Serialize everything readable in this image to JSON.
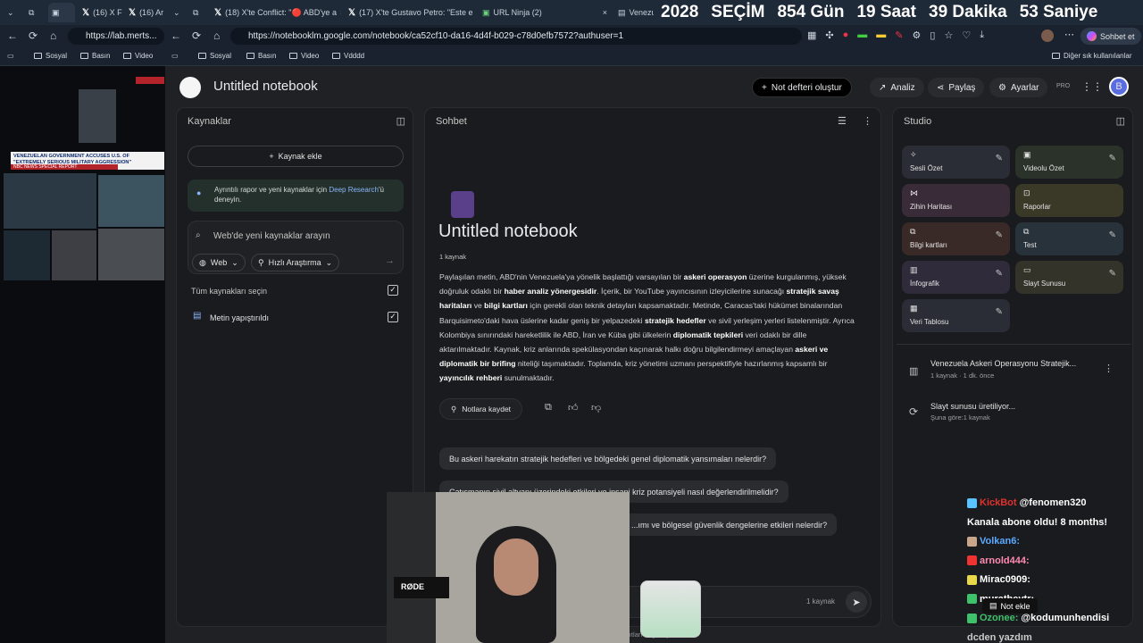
{
  "countdown": {
    "year": "2028",
    "label": "SEÇİM",
    "days": "854 Gün",
    "hours": "19 Saat",
    "minutes": "39 Dakika",
    "seconds": "53 Saniye"
  },
  "tabs": [
    {
      "title": "(16) X F"
    },
    {
      "title": "(16) Ar"
    },
    {
      "title": "(18) X'te Conflict: \"🔴 ABD'ye a"
    },
    {
      "title": "(17) X'te Gustavo Petro: \"Este e"
    },
    {
      "title": "URL Ninja (2)"
    },
    {
      "title": "Venezu"
    }
  ],
  "address": {
    "left_url": "https://lab.merts...",
    "url": "https://notebooklm.google.com/notebook/ca52cf10-da16-4d4f-b029-c78d0efb7572?authuser=1",
    "chat_btn": "Sohbet et"
  },
  "bookmarks": {
    "left": [
      "Sosyal",
      "Basın",
      "Video"
    ],
    "right": [
      "Sosyal",
      "Basın",
      "Video",
      "Vdddd"
    ],
    "other": "Diğer sık kullanılanlar"
  },
  "stream": {
    "headline": "VENEZUELAN GOVERNMENT ACCUSES U.S. OF \"EXTREMELY SERIOUS MILITARY AGGRESSION\"",
    "source": "NBC NEWS SPECIAL REPORT"
  },
  "app": {
    "title": "Untitled notebook",
    "create_btn": "Not defteri oluştur",
    "analytics": "Analiz",
    "share": "Paylaş",
    "settings": "Ayarlar",
    "pro": "PRO",
    "avatar": "B"
  },
  "sources": {
    "title": "Kaynaklar",
    "add": "Kaynak ekle",
    "deep_research_pre": "Ayrıntılı rapor ve yeni kaynaklar için ",
    "deep_research_link": "Deep Research",
    "deep_research_post": "'ü",
    "deep_research_line2": "deneyin.",
    "search_placeholder": "Web'de yeni kaynaklar arayın",
    "web_btn": "Web",
    "fast_btn": "Hızlı Araştırma",
    "select_all": "Tüm kaynakları seçin",
    "item": "Metin yapıştırıldı"
  },
  "chat": {
    "title": "Sohbet",
    "notebook_title": "Untitled notebook",
    "source_count": "1 kaynak",
    "summary_html_segments": [
      [
        "Paylaşılan metin, ABD'nin Venezuela'ya yönelik başlattığı varsayılan bir ",
        false
      ],
      [
        "askeri operasyon",
        true
      ],
      [
        " üzerine kurgulanmış, yüksek doğruluk odaklı bir ",
        false
      ],
      [
        "haber analiz yönergesidir",
        true
      ],
      [
        ". İçerik, bir YouTube yayıncısının izleyicilerine sunacağı ",
        false
      ],
      [
        "stratejik savaş haritaları",
        true
      ],
      [
        " ve ",
        false
      ],
      [
        "bilgi kartları",
        true
      ],
      [
        " için gerekli olan teknik detayları kapsamaktadır. Metinde, Caracas'taki hükümet binalarından Barquisimeto'daki hava üslerine kadar geniş bir yelpazedeki ",
        false
      ],
      [
        "stratejik hedefler",
        true
      ],
      [
        " ve sivil yerleşim yerleri listelenmiştir. Ayrıca Kolombiya sınırındaki hareketlilik ile ABD, İran ve Küba gibi ülkelerin ",
        false
      ],
      [
        "diplomatik tepkileri",
        true
      ],
      [
        " veri odaklı bir dille aktarılmaktadır. Kaynak, kriz anlarında spekülasyondan kaçınarak halkı doğru bilgilendirmeyi amaçlayan ",
        false
      ],
      [
        "askeri ve diplomatik bir brifing",
        true
      ],
      [
        " niteliği taşımaktadır. Toplamda, kriz yönetimi uzmanı perspektifiyle hazırlanmış kapsamlı bir ",
        false
      ],
      [
        "yayıncılık rehberi",
        true
      ],
      [
        " sunulmaktadır.",
        false
      ]
    ],
    "save_note": "Notlara kaydet",
    "questions": [
      "Bu askeri harekatın stratejik hedefleri ve bölgedeki genel diplomatik yansımaları nelerdir?",
      "Çatışmanın sivil altyapı üzerindeki etkileri ve insani kriz potansiyeli nasıl değerlendirilmelidir?",
      "...ımı ve bölgesel güvenlik dengelerine etkileri nelerdir?"
    ],
    "input_count": "1 kaynak",
    "footer": "...erdiği yanıtları doğrulayın."
  },
  "studio": {
    "title": "Studio",
    "cards": [
      {
        "label": "Sesli Özet",
        "color": "#2a2d35"
      },
      {
        "label": "Videolu Özet",
        "color": "#2a3229"
      },
      {
        "label": "Zihin Haritası",
        "color": "#3a2b38"
      },
      {
        "label": "Raporlar",
        "color": "#3a3827"
      },
      {
        "label": "Bilgi kartları",
        "color": "#3a2a27"
      },
      {
        "label": "Test",
        "color": "#27323a"
      },
      {
        "label": "İnfografik",
        "color": "#2f2b3a"
      },
      {
        "label": "Slayt Sunusu",
        "color": "#33332a"
      },
      {
        "label": "Veri Tablosu",
        "color": "#2a2d35"
      }
    ],
    "output_title": "Venezuela Askeri Operasyonu Stratejik...",
    "output_meta": "1 kaynak · 1 dk. önce",
    "generating": "Slayt sunusu üretiliyor...",
    "generating_meta": "Şuna göre:1 kaynak",
    "add_note": "Not ekle"
  },
  "overlay": {
    "lines": [
      {
        "user": "KickBot",
        "text": "@fenomen320",
        "color": "#e0312e"
      },
      {
        "user": "",
        "text": "Kanala abone oldu! 8 months!",
        "color": "#ffffff"
      },
      {
        "user": "Volkan6:",
        "text": "",
        "color": "#5aa9ff"
      },
      {
        "user": "arnold444:",
        "text": "",
        "color": "#ff8ab0"
      },
      {
        "user": "Mirac0909:",
        "text": "",
        "color": "#ffffff"
      },
      {
        "user": "muratbeytr:",
        "text": "",
        "color": "#ffffff"
      },
      {
        "user": "Ozonee:",
        "text": "@kodumunhendisi",
        "color": "#3fc06a"
      },
      {
        "user": "",
        "text": "dcden yazdım",
        "color": "#c9c9c9"
      }
    ]
  }
}
